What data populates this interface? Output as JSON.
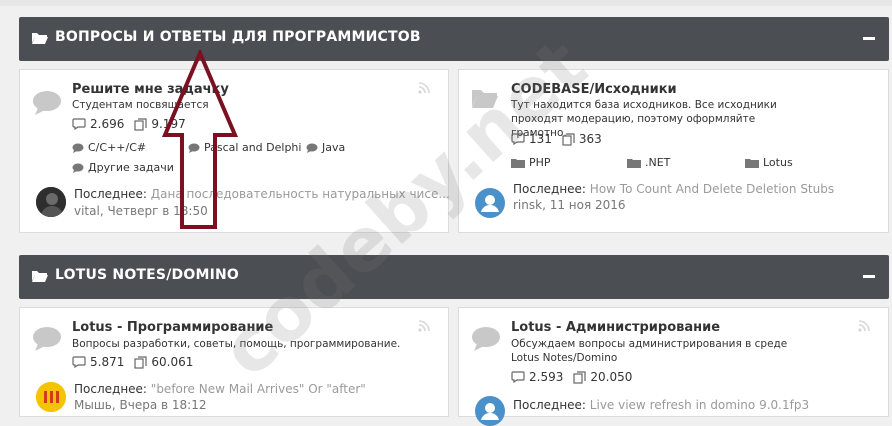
{
  "sections": [
    {
      "title": "ВОПРОСЫ И ОТВЕТЫ ДЛЯ ПРОГРАММИСТОВ",
      "nodes": [
        {
          "title": "Решите мне задачку",
          "description": "Студентам посвящается",
          "stats": {
            "threads": "2.696",
            "messages": "9.197"
          },
          "subforums": [
            "C/C++/C#",
            "Pascal and Delphi",
            "Java",
            "Другие задачи"
          ],
          "last": {
            "label": "Последнее:",
            "thread": "Дана последовательность натуральных чисе...",
            "user": "vital",
            "date": ", Четверг в 18:50"
          }
        },
        {
          "title": "CODEBASE/Исходники",
          "description": "Тут находится база исходников. Все исходники проходят модерацию, поэтому оформляйте грамотно.",
          "stats": {
            "threads": "131",
            "messages": "363"
          },
          "subforums": [
            "PHP",
            ".NET",
            "Lotus"
          ],
          "last": {
            "label": "Последнее:",
            "thread": "How To Count And Delete Deletion Stubs",
            "user": "rinsk",
            "date": ", 11 ноя 2016"
          }
        }
      ]
    },
    {
      "title": "LOTUS NOTES/DOMINO",
      "nodes": [
        {
          "title": "Lotus - Программирование",
          "description": "Вопросы разработки, советы, помощь, программирование.",
          "stats": {
            "threads": "5.871",
            "messages": "60.061"
          },
          "last": {
            "label": "Последнее:",
            "thread": "\"before New Mail Arrives\" Or \"after\"",
            "user": "Мышь",
            "date": ", Вчера в 18:12"
          }
        },
        {
          "title": "Lotus - Администрирование",
          "description": "Обсуждаем вопросы администрирования в среде Lotus Notes/Domino",
          "stats": {
            "threads": "2.593",
            "messages": "20.050"
          },
          "last": {
            "label": "Последнее:",
            "thread": "Live view refresh in domino 9.0.1fp3"
          }
        }
      ]
    }
  ],
  "watermark": "codeby.net",
  "colors": {
    "header_bg": "#4b4e52",
    "annotation": "#7a1020",
    "avatar_blue": "#4a90c9"
  }
}
